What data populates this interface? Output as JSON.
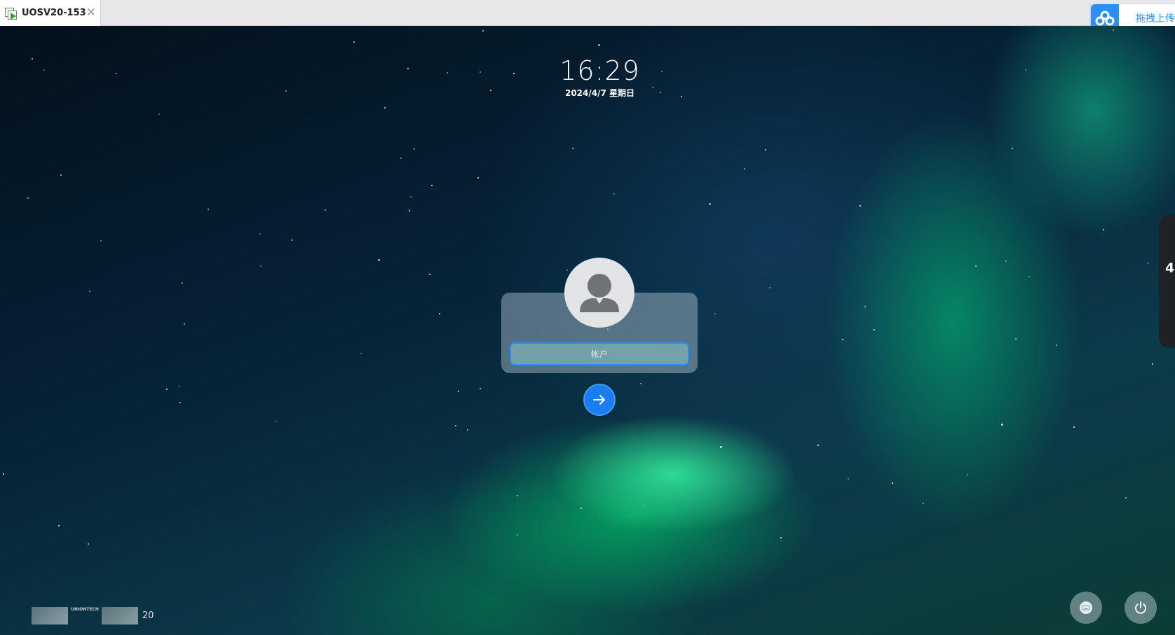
{
  "tab": {
    "title": "UOSV20-153",
    "icon": "vm-play-icon",
    "close_icon": "close-icon"
  },
  "cloud_widget": {
    "label": "拖拽上传",
    "icon": "cloud-icon"
  },
  "lock_screen": {
    "time": "16:29",
    "date": "2024/4/7 星期日",
    "account_placeholder": "帐户",
    "avatar_icon": "user-avatar-icon",
    "submit_icon": "arrow-right-icon"
  },
  "branding": {
    "logo_text": "UNIONTECH",
    "version": "20"
  },
  "side_widget": {
    "value": "4"
  },
  "corner_buttons": [
    {
      "icon": "keyboard-icon"
    },
    {
      "icon": "power-icon"
    }
  ],
  "colors": {
    "accent": "#1a7df0",
    "tab_bar": "#e8e8ea"
  }
}
